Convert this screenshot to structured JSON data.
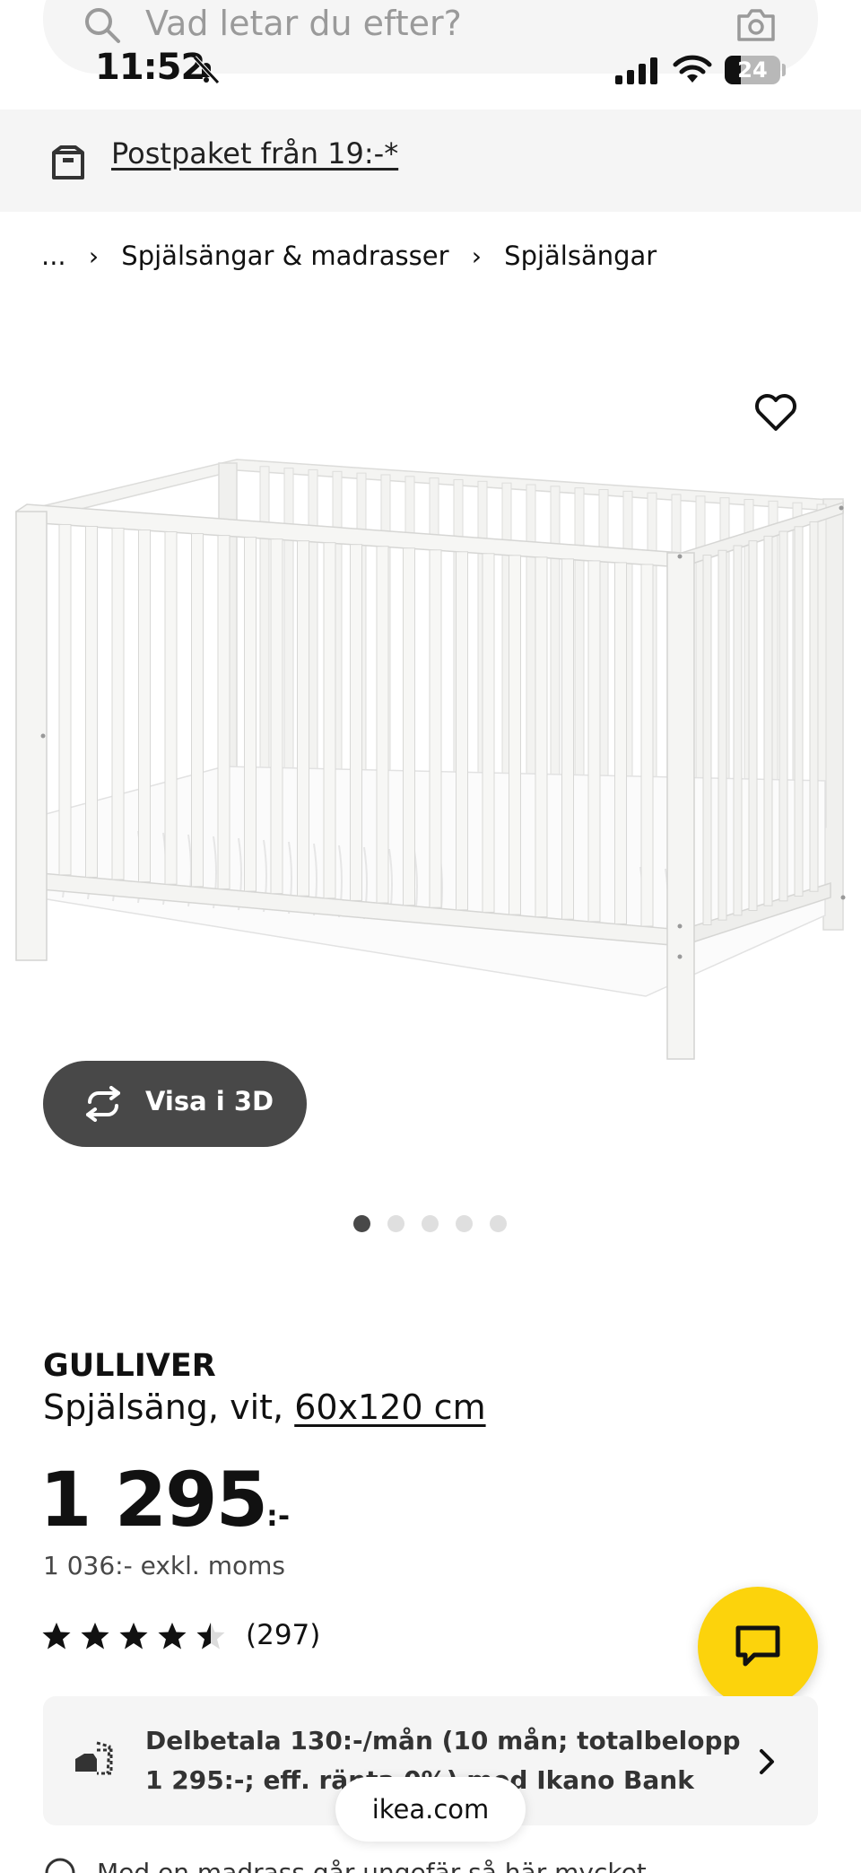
{
  "status_bar": {
    "time": "11:52",
    "battery": "24"
  },
  "search": {
    "placeholder": "Vad letar du efter?"
  },
  "promo": {
    "text": "Postpaket från 19:-*"
  },
  "breadcrumb": {
    "ellipsis": "...",
    "items": [
      "Spjälsängar & madrasser",
      "Spjälsängar"
    ]
  },
  "gallery": {
    "view_3d_label": "Visa i 3D",
    "dots_total": 5,
    "active_dot": 1
  },
  "product": {
    "name": "GULLIVER",
    "description": "Spjälsäng, vit,",
    "size": "60x120 cm",
    "price": "1 295",
    "price_suffix": ":-",
    "price_ex_vat": "1 036:- exkl. moms",
    "rating": 4.5,
    "review_count": "(297)"
  },
  "finance": {
    "text": "Delbetala 130:-/mån (10 mån; totalbelopp 1 295:-; eff. ränta 0%) med Ikano Bank"
  },
  "browser": {
    "url": "ikea.com"
  },
  "bottom_partial": {
    "text": "Med en madrass går ungefär så här mycket..."
  },
  "colors": {
    "accent_yellow": "#fcd30c",
    "button_dark": "#484848",
    "panel_gray": "#f5f5f5"
  }
}
